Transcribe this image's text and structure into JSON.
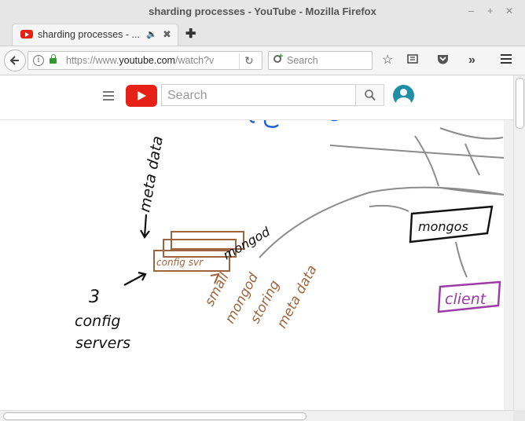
{
  "window": {
    "title": "sharding processes - YouTube - Mozilla Firefox",
    "minimize_glyph": "–",
    "maximize_glyph": "+",
    "close_glyph": "✕"
  },
  "tab": {
    "title": "sharding processes - ...",
    "audio_glyph": "🔉",
    "close_glyph": "✖",
    "new_tab_glyph": "✚"
  },
  "navbar": {
    "url_prefix": "https://www.",
    "url_domain": "youtube.com",
    "url_path": "/watch?v",
    "search_placeholder": "Search",
    "reload_glyph": "↻",
    "info_glyph": "i"
  },
  "youtube": {
    "search_placeholder": "Search"
  },
  "video": {
    "labels": {
      "meta_data": "meta data",
      "config_box": "config svr",
      "mongod": "mongod",
      "three": "3",
      "config": "config",
      "servers": "servers",
      "small": "small",
      "mongod_note": "mongod",
      "storing": "storing",
      "meta_data_note": "meta data",
      "mongos": "mongos",
      "client": "client"
    },
    "colors": {
      "ink": "#111111",
      "brown": "#a0643c",
      "purple": "#9c3aa8",
      "gray": "#8c8c8c",
      "blue": "#1f5fd0"
    }
  },
  "icons": [
    "back-arrow-icon",
    "info-icon",
    "lock-icon",
    "reload-icon",
    "search-engine-icon",
    "star-icon",
    "reading-list-icon",
    "pocket-icon",
    "overflow-icon",
    "hamburger-menu-icon",
    "youtube-logo-icon",
    "search-icon",
    "avatar-icon",
    "audio-icon"
  ]
}
